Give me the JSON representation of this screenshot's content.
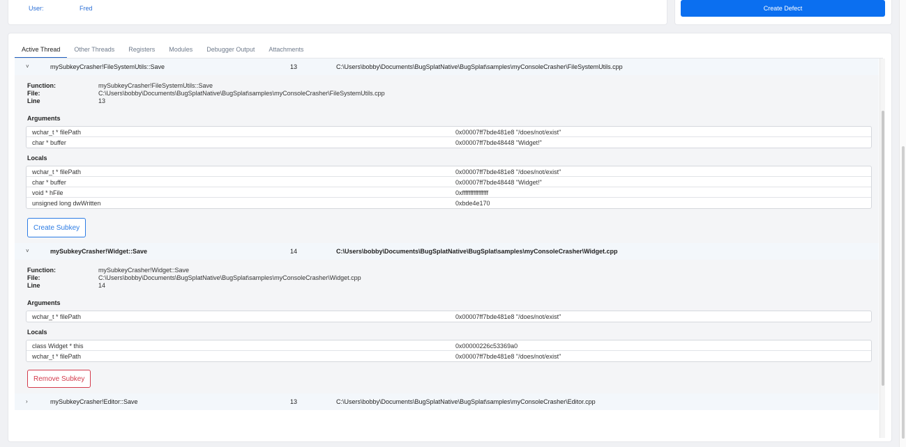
{
  "header": {
    "user_label": "User:",
    "user_value": "Fred",
    "create_defect_label": "Create Defect"
  },
  "tabs": [
    {
      "label": "Active Thread",
      "active": true
    },
    {
      "label": "Other Threads",
      "active": false
    },
    {
      "label": "Registers",
      "active": false
    },
    {
      "label": "Modules",
      "active": false
    },
    {
      "label": "Debugger Output",
      "active": false
    },
    {
      "label": "Attachments",
      "active": false
    }
  ],
  "field_labels": {
    "function": "Function:",
    "file": "File:",
    "line": "Line",
    "arguments": "Arguments",
    "locals": "Locals"
  },
  "frames": [
    {
      "chevron": "˅",
      "function": "mySubkeyCrasher!FileSystemUtils::Save",
      "line": "13",
      "path": "C:\\Users\\bobby\\Documents\\BugSplatNative\\BugSplat\\samples\\myConsoleCrasher\\FileSystemUtils.cpp",
      "arguments": [
        {
          "name": "wchar_t * filePath",
          "value": "0x00007ff7bde481e8 \"/does/not/exist\""
        },
        {
          "name": "char * buffer",
          "value": "0x00007ff7bde48448 \"Widget!\""
        }
      ],
      "locals": [
        {
          "name": "wchar_t * filePath",
          "value": "0x00007ff7bde481e8 \"/does/not/exist\""
        },
        {
          "name": "char * buffer",
          "value": "0x00007ff7bde48448 \"Widget!\""
        },
        {
          "name": "void * hFile",
          "value": "0xffffffffffffffff"
        },
        {
          "name": "unsigned long dwWritten",
          "value": "0xbde4e170"
        }
      ],
      "button_label": "Create Subkey"
    },
    {
      "chevron": "˅",
      "function": "mySubkeyCrasher!Widget::Save",
      "line": "14",
      "path": "C:\\Users\\bobby\\Documents\\BugSplatNative\\BugSplat\\samples\\myConsoleCrasher\\Widget.cpp",
      "arguments": [
        {
          "name": "wchar_t * filePath",
          "value": "0x00007ff7bde481e8 \"/does/not/exist\""
        }
      ],
      "locals": [
        {
          "name": "class Widget * this",
          "value": "0x00000226c53369a0"
        },
        {
          "name": "wchar_t * filePath",
          "value": "0x00007ff7bde481e8 \"/does/not/exist\""
        }
      ],
      "button_label": "Remove Subkey"
    },
    {
      "chevron": "›",
      "function": "mySubkeyCrasher!Editor::Save",
      "line": "13",
      "path": "C:\\Users\\bobby\\Documents\\BugSplatNative\\BugSplat\\samples\\myConsoleCrasher\\Editor.cpp"
    }
  ]
}
